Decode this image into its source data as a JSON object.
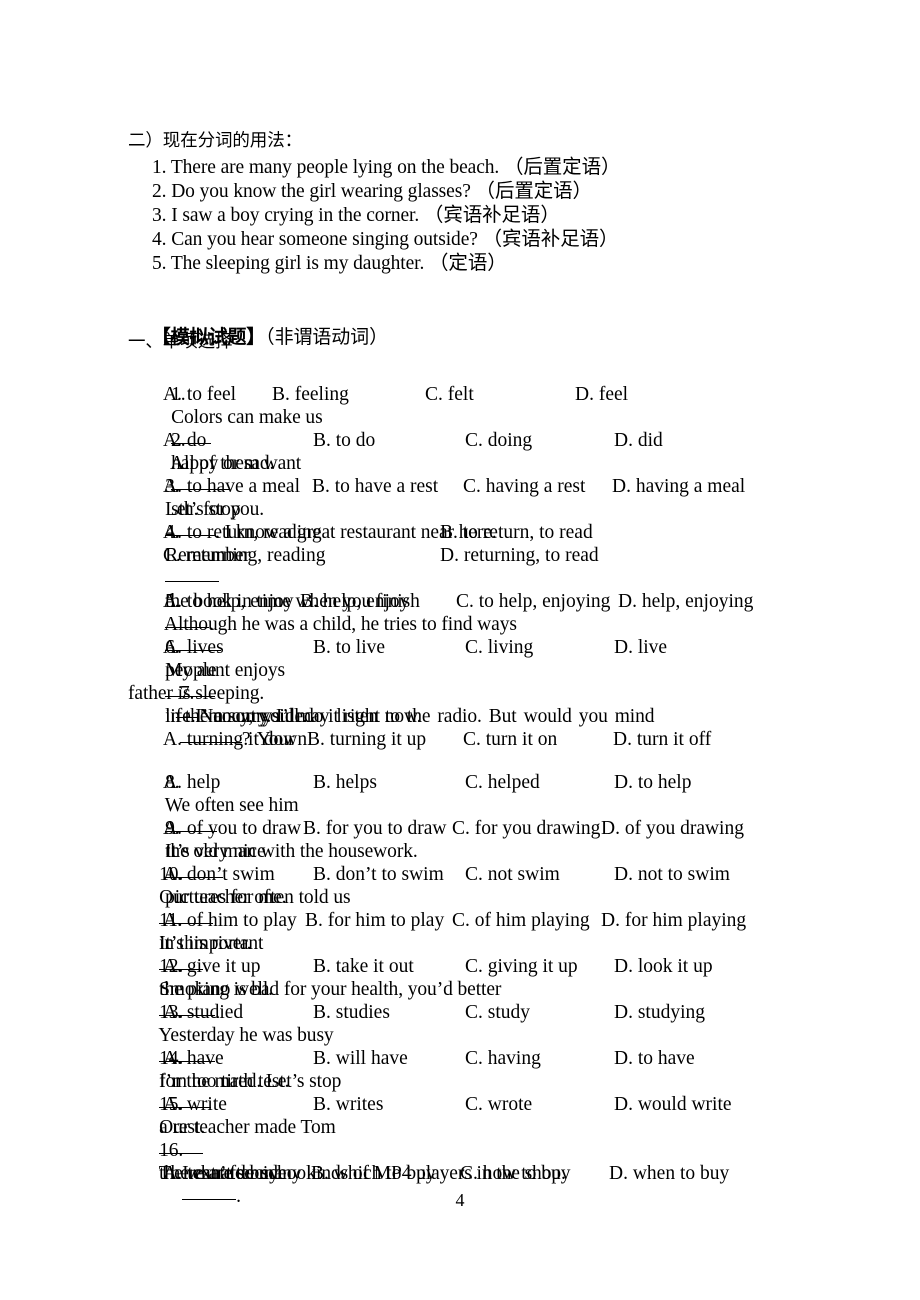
{
  "document": {
    "page_number": "4",
    "section_heading": "二）现在分词的用法：",
    "participle_examples": [
      "1. There are many people lying on the beach. （后置定语）",
      "2. Do you know the girl wearing glasses? （后置定语）",
      "3. I saw a boy crying in the corner. （宾语补足语）",
      "4. Can you hear someone singing outside? （宾语补足语）",
      "5. The sleeping girl is my daughter. （定语）"
    ],
    "exercise_title_bold": "【模拟试题】",
    "exercise_title_rest": "（非谓语动词）",
    "part_one_heading": "一、单项选择",
    "questions": [
      {
        "number": "1.",
        "stem_before": "Colors can make us",
        "stem_after": "happy or sad.",
        "options": [
          "A. to feel",
          "B. feeling",
          "C. felt",
          "D. feel"
        ]
      },
      {
        "number": "2.",
        "stem_before": "All of them want",
        "stem_after": "sth. for you.",
        "options": [
          "A. do",
          "B. to do",
          "C. doing",
          "D. did"
        ]
      },
      {
        "number": "3.",
        "stem_before": "Let’s stop",
        "stem_after": ". I know a great restaurant near here.",
        "options": [
          "A. to have a meal",
          "B. to have a rest",
          "C. having a rest",
          "D. having a meal"
        ]
      },
      {
        "number": "4.",
        "stem_before": "Remember",
        "stem_mid": "the book in time when you finish",
        "stem_after": ".",
        "options": [
          "A. to return, reading",
          "B. to return, to read",
          "C. returning, reading",
          "D. returning, to read"
        ]
      },
      {
        "number": "5.",
        "stem_before": "Although he was a child, he tries to find ways",
        "stem_mid": "people",
        "stem_after": "life.",
        "options": [
          "A. to help, enjoy",
          "B. help, enjoy",
          "C. to help, enjoying",
          "D. help, enjoying"
        ]
      },
      {
        "number": "6.",
        "stem_before": "My aunt enjoys",
        "stem_after": "in the countryside.",
        "options": [
          "A. lives",
          "B. to live",
          "C. living",
          "D. live"
        ]
      },
      {
        "number": "7.",
        "stem_line1": "—Nancy, you may listen to the radio. But would you mind",
        "stem_line1_tail": "? Your",
        "stem_line2": "father is sleeping.",
        "stem_line3": "—I’m sorry. I’ll do it right now.",
        "options": [
          "A. turning it down",
          "B. turning it up",
          "C. turn it on",
          "D. turn it off"
        ]
      },
      {
        "number": "8.",
        "stem_before": "We often see him",
        "stem_after": "the old man with the housework.",
        "options": [
          "A. help",
          "B. helps",
          "C. helped",
          "D. to help"
        ]
      },
      {
        "number": "9.",
        "stem_before": "It’s very nice",
        "stem_after": "pictures for me.",
        "options": [
          "A. of you to draw",
          "B. for you to draw",
          "C. for you drawing",
          "D. of you drawing"
        ]
      },
      {
        "number": "10.",
        "stem_before": "Our teacher often told us",
        "stem_after": "in this river.",
        "options": [
          "A. don’t swim",
          "B. don’t to swim",
          "C. not swim",
          "D. not to swim"
        ]
      },
      {
        "number": "11.",
        "stem_before": "It’s important",
        "stem_after": "the piano well.",
        "options": [
          "A. of him to play",
          "B. for him to play",
          "C. of him playing",
          "D. for him playing"
        ]
      },
      {
        "number": "12.",
        "stem_before": "Smoking is bad for your health, you’d better",
        "stem_after": ".",
        "options": [
          "A. give it up",
          "B. take it out",
          "C. giving it up",
          "D. look it up"
        ]
      },
      {
        "number": "13.",
        "stem_before": "Yesterday he was busy",
        "stem_after": "for the math test.",
        "options": [
          "A. studied",
          "B. studies",
          "C. study",
          "D. studying"
        ]
      },
      {
        "number": "14.",
        "stem_before": "I’m too tired. Let’s stop",
        "stem_after": "a rest.",
        "options": [
          "A. have",
          "B. will have",
          "C. having",
          "D. to have"
        ]
      },
      {
        "number": "15.",
        "stem_before": "Our teacher made Tom",
        "stem_after": "the text after school.",
        "options": [
          "A. write",
          "B. writes",
          "C. wrote",
          "D. would write"
        ]
      },
      {
        "number": "16.",
        "stem_line1": "There are so many kinds of MP4 players in the shop.",
        "stem_line2_before": "I can’t decide",
        "stem_line2_after": ".",
        "options": [
          "A. what to buy",
          "B. which to buy",
          "C. how to buy",
          "D. when to buy"
        ]
      }
    ]
  }
}
